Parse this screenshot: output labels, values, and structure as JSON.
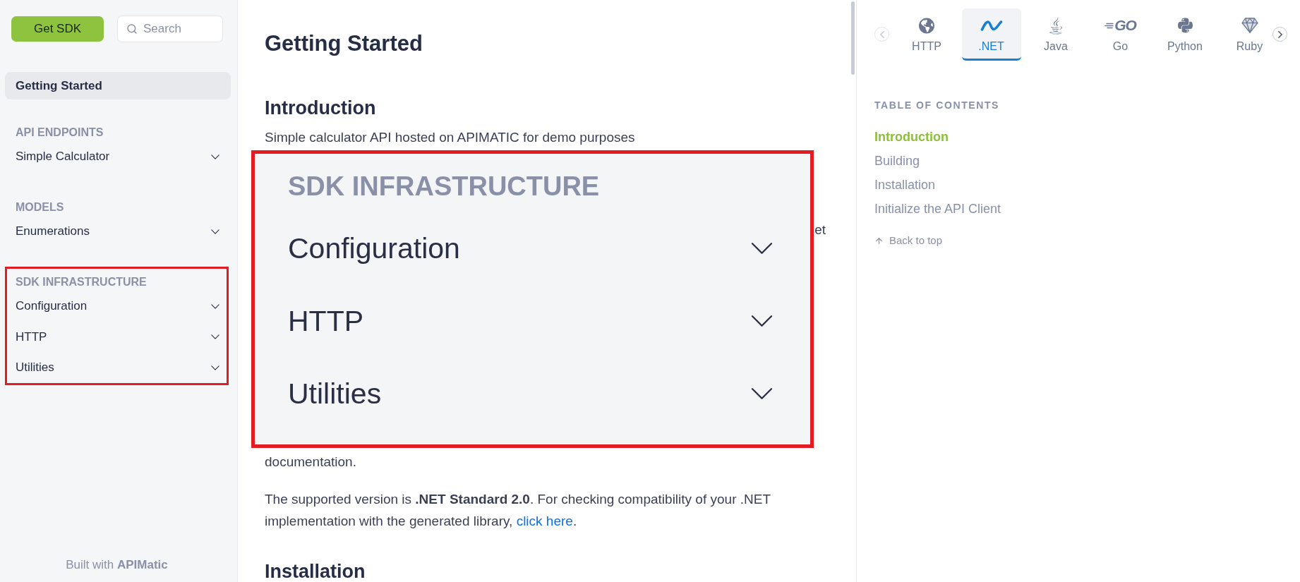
{
  "sidebar": {
    "get_sdk_button": "Get SDK",
    "search": {
      "placeholder": "Search"
    },
    "pages": [
      {
        "label": "Getting Started",
        "selected": true
      }
    ],
    "sections": [
      {
        "title": "API ENDPOINTS",
        "highlighted": false,
        "items": [
          {
            "label": "Simple Calculator",
            "expanded": false
          }
        ]
      },
      {
        "title": "MODELS",
        "highlighted": false,
        "items": [
          {
            "label": "Enumerations",
            "expanded": false
          }
        ]
      },
      {
        "title": "SDK INFRASTRUCTURE",
        "highlighted": true,
        "items": [
          {
            "label": "Configuration",
            "expanded": false
          },
          {
            "label": "HTTP",
            "expanded": false
          },
          {
            "label": "Utilities",
            "expanded": false
          }
        ]
      }
    ],
    "footer": "Built with **APIMatic**"
  },
  "content": {
    "title": "Getting Started",
    "blocks": [
      {
        "kind": "heading",
        "text": "Introduction"
      },
      {
        "kind": "paragraph",
        "text": "Simple calculator API hosted on APIMATIC for demo purposes"
      },
      {
        "kind": "covered",
        "fragment": "et"
      },
      {
        "kind": "paragraph",
        "text": "documentation."
      },
      {
        "kind": "paragraph",
        "text": "The supported version is **.NET Standard 2.0**. For checking compatibility of your .NET implementation with the generated library, ",
        "link": "click here",
        "text_after": "."
      },
      {
        "kind": "heading",
        "text": "Installation"
      }
    ],
    "callout": {
      "title": "SDK INFRASTRUCTURE",
      "items": [
        {
          "label": "Configuration",
          "expanded": false
        },
        {
          "label": "HTTP",
          "expanded": false
        },
        {
          "label": "Utilities",
          "expanded": false
        }
      ]
    }
  },
  "language_tabs": {
    "prev_disabled": true,
    "next_disabled": false,
    "tabs": [
      {
        "kind": "http",
        "label": "HTTP",
        "selected": false
      },
      {
        "kind": "dotnet",
        "label": ".NET",
        "selected": true
      },
      {
        "kind": "java",
        "label": "Java",
        "selected": false
      },
      {
        "kind": "go",
        "label": "Go",
        "logo_text": "GO",
        "selected": false
      },
      {
        "kind": "python",
        "label": "Python",
        "selected": false
      },
      {
        "kind": "ruby",
        "label": "Ruby",
        "selected": false
      }
    ]
  },
  "toc": {
    "title": "TABLE OF CONTENTS",
    "items": [
      {
        "label": "Introduction",
        "selected": true
      },
      {
        "label": "Building",
        "selected": false
      },
      {
        "label": "Installation",
        "selected": false
      },
      {
        "label": "Initialize the API Client",
        "selected": false
      }
    ],
    "back_to_top": "Back to top"
  }
}
